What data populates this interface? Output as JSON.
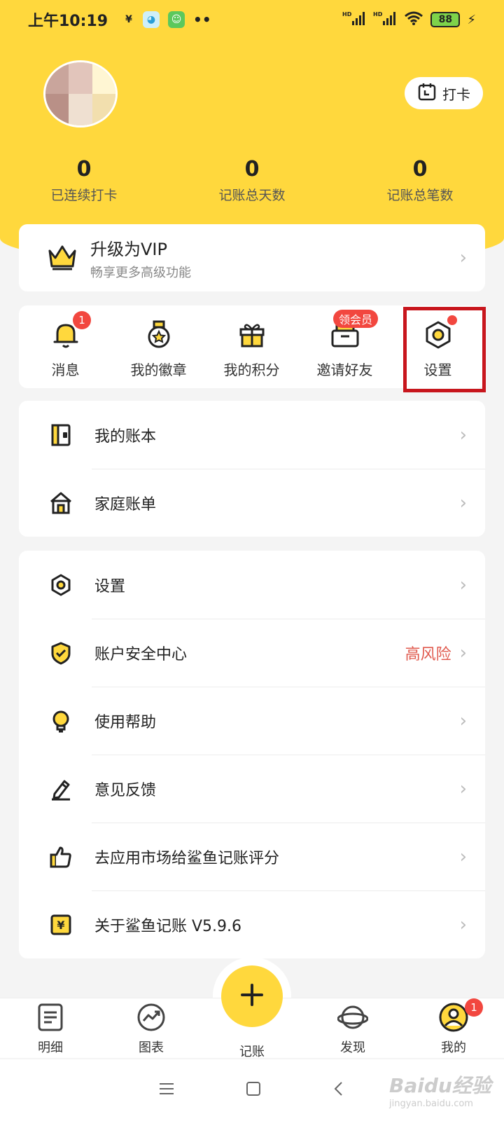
{
  "status_bar": {
    "time": "上午10:19",
    "battery": "88"
  },
  "header": {
    "checkin_label": "打卡",
    "stats": [
      {
        "value": "0",
        "label": "已连续打卡"
      },
      {
        "value": "0",
        "label": "记账总天数"
      },
      {
        "value": "0",
        "label": "记账总笔数"
      }
    ]
  },
  "vip": {
    "title": "升级为VIP",
    "subtitle": "畅享更多高级功能"
  },
  "quick_actions": [
    {
      "label": "消息",
      "icon": "bell-icon",
      "badge": "1"
    },
    {
      "label": "我的徽章",
      "icon": "medal-icon"
    },
    {
      "label": "我的积分",
      "icon": "gift-icon"
    },
    {
      "label": "邀请好友",
      "icon": "envelope-icon",
      "badge": "领会员"
    },
    {
      "label": "设置",
      "icon": "gear-icon"
    }
  ],
  "list_group_1": [
    {
      "label": "我的账本",
      "icon": "ledger-icon"
    },
    {
      "label": "家庭账单",
      "icon": "house-icon"
    }
  ],
  "list_group_2": [
    {
      "label": "设置",
      "icon": "gear-icon"
    },
    {
      "label": "账户安全中心",
      "icon": "shield-icon",
      "status": "高风险"
    },
    {
      "label": "使用帮助",
      "icon": "bulb-icon"
    },
    {
      "label": "意见反馈",
      "icon": "pencil-icon"
    },
    {
      "label": "去应用市场给鲨鱼记账评分",
      "icon": "thumbs-up-icon"
    },
    {
      "label": "关于鲨鱼记账 V5.9.6",
      "icon": "yen-icon"
    }
  ],
  "tab_bar": [
    {
      "label": "明细",
      "icon": "document-icon"
    },
    {
      "label": "图表",
      "icon": "chart-icon"
    },
    {
      "label": "记账",
      "icon": "plus-icon"
    },
    {
      "label": "发现",
      "icon": "planet-icon"
    },
    {
      "label": "我的",
      "icon": "user-icon",
      "badge": "1"
    }
  ],
  "watermark": {
    "text": "Baidu经验",
    "sub": "jingyan.baidu.com"
  },
  "colors": {
    "accent": "#ffd83d",
    "badge": "#f2473f",
    "risk": "#e05a4e",
    "highlight": "#c8161d"
  }
}
